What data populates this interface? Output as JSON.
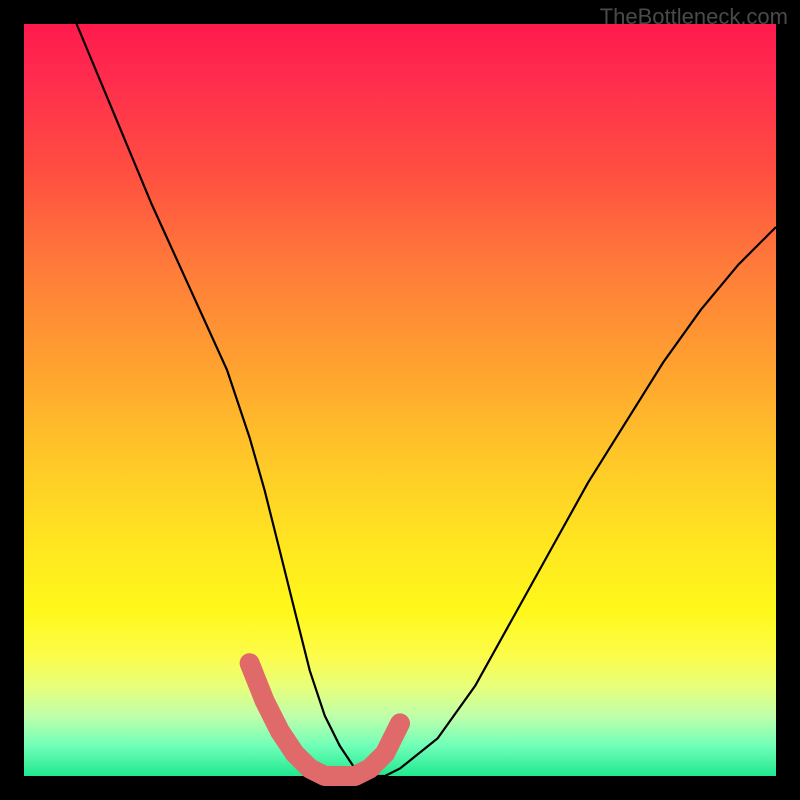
{
  "watermark": "TheBottleneck.com",
  "chart_data": {
    "type": "line",
    "title": "",
    "xlabel": "",
    "ylabel": "",
    "xlim": [
      0,
      100
    ],
    "ylim": [
      0,
      100
    ],
    "series": [
      {
        "name": "curve",
        "x": [
          7,
          12,
          17,
          22,
          27,
          30,
          32,
          34,
          36,
          38,
          40,
          42,
          44,
          46,
          48,
          50,
          55,
          60,
          65,
          70,
          75,
          80,
          85,
          90,
          95,
          100
        ],
        "y": [
          100,
          88,
          76,
          65,
          54,
          45,
          38,
          30,
          22,
          14,
          8,
          4,
          1,
          0,
          0,
          1,
          5,
          12,
          21,
          30,
          39,
          47,
          55,
          62,
          68,
          73
        ]
      }
    ],
    "highlight_region": {
      "x": [
        30,
        32,
        34,
        36,
        38,
        40,
        42,
        44,
        46,
        48,
        50
      ],
      "y": [
        15,
        10,
        6,
        3,
        1,
        0,
        0,
        0,
        1,
        3,
        7
      ]
    },
    "highlight_color": "#e06a6a",
    "background_gradient": {
      "top": "#ff1a4d",
      "bottom": "#20e890"
    }
  }
}
